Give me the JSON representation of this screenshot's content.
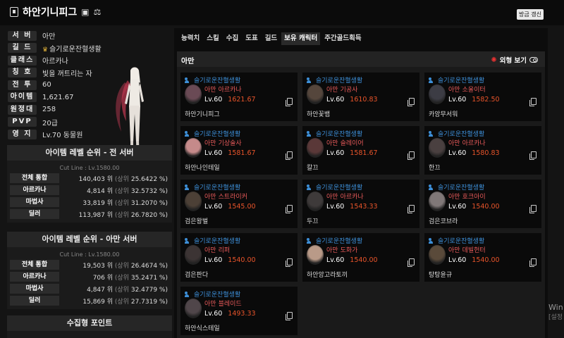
{
  "header": {
    "title": "하안기니피그",
    "refresh_label": "방금 갱신"
  },
  "profile": {
    "rows": [
      {
        "label": "서 버",
        "value": "아만",
        "crown": false
      },
      {
        "label": "길 드",
        "value": "슬기로운잔혈생활",
        "crown": true
      },
      {
        "label": "클래스",
        "value": "아르카나",
        "crown": false
      },
      {
        "label": "칭 호",
        "value": "빛을 꺼트리는 자",
        "crown": false
      },
      {
        "label": "전 투",
        "value": "60",
        "crown": false
      },
      {
        "label": "아이템",
        "value": "1,621.67",
        "crown": false
      },
      {
        "label": "원정대",
        "value": "258",
        "crown": false
      },
      {
        "label": "PVP",
        "value": "20급",
        "crown": false
      },
      {
        "label": "영 지",
        "value": "Lv.70 동물원",
        "crown": false
      }
    ]
  },
  "rank_all": {
    "title": "아이템 레벨 순위 - 전 서버",
    "cutline": "Cut Line : Lv.1580.00",
    "rows": [
      {
        "label": "전체 통합",
        "rank": "140,403 위",
        "pct_label": "(상위",
        "pct": "25.6422 %)"
      },
      {
        "label": "아르카나",
        "rank": "4,814 위",
        "pct_label": "(상위",
        "pct": "32.5732 %)"
      },
      {
        "label": "마법사",
        "rank": "33,819 위",
        "pct_label": "(상위",
        "pct": "31.2070 %)"
      },
      {
        "label": "딜러",
        "rank": "113,987 위",
        "pct_label": "(상위",
        "pct": "26.7820 %)"
      }
    ]
  },
  "rank_server": {
    "title": "아이템 레벨 순위 - 아만 서버",
    "cutline": "Cut Line : Lv.1580.00",
    "rows": [
      {
        "label": "전체 통합",
        "rank": "19,503 위",
        "pct_label": "(상위",
        "pct": "26.4674 %)"
      },
      {
        "label": "아르카나",
        "rank": "706 위",
        "pct_label": "(상위",
        "pct": "35.2471 %)"
      },
      {
        "label": "마법사",
        "rank": "4,847 위",
        "pct_label": "(상위",
        "pct": "32.4779 %)"
      },
      {
        "label": "딜러",
        "rank": "15,869 위",
        "pct_label": "(상위",
        "pct": "27.7319 %)"
      }
    ]
  },
  "collect": {
    "title": "수집형 포인트"
  },
  "tabs": [
    "능력치",
    "스킬",
    "수집",
    "도표",
    "길드",
    "보유 캐릭터",
    "주간골드획득"
  ],
  "active_tab": 5,
  "roster": {
    "server": "아만",
    "view_label": "외형 보기",
    "characters": [
      {
        "guild": "슬기로운잔혈생활",
        "server": "아만",
        "class": "아르카나",
        "level": "Lv.60",
        "ilvl": "1621.67",
        "name": "하안기니피그",
        "tone": "#6a4a55"
      },
      {
        "guild": "슬기로운잔혈생활",
        "server": "아만",
        "class": "기공사",
        "level": "Lv.60",
        "ilvl": "1610.83",
        "name": "하안꽃뱀",
        "tone": "#55463c"
      },
      {
        "guild": "슬기로운잔혈생활",
        "server": "아만",
        "class": "소울이터",
        "level": "Lv.60",
        "ilvl": "1582.50",
        "name": "카앙무서워",
        "tone": "#3c3c44"
      },
      {
        "guild": "슬기로운잔혈생활",
        "server": "아만",
        "class": "기상술사",
        "level": "Lv.60",
        "ilvl": "1581.67",
        "name": "하안나인테일",
        "tone": "#c58a8a"
      },
      {
        "guild": "슬기로운잔혈생활",
        "server": "아만",
        "class": "슬레이어",
        "level": "Lv.60",
        "ilvl": "1581.67",
        "name": "칼끄",
        "tone": "#5a3838"
      },
      {
        "guild": "슬기로운잔혈생활",
        "server": "아만",
        "class": "아르카나",
        "level": "Lv.60",
        "ilvl": "1580.83",
        "name": "한끄",
        "tone": "#4a4040"
      },
      {
        "guild": "슬기로운잔혈생활",
        "server": "아만",
        "class": "스트라이커",
        "level": "Lv.60",
        "ilvl": "1545.00",
        "name": "검은왕벌",
        "tone": "#4c4036"
      },
      {
        "guild": "슬기로운잔혈생활",
        "server": "아만",
        "class": "아르카나",
        "level": "Lv.60",
        "ilvl": "1543.33",
        "name": "두끄",
        "tone": "#3e3a3a"
      },
      {
        "guild": "슬기로운잔혈생활",
        "server": "아만",
        "class": "호크아이",
        "level": "Lv.60",
        "ilvl": "1540.00",
        "name": "검은코브라",
        "tone": "#807878"
      },
      {
        "guild": "슬기로운잔혈생활",
        "server": "아만",
        "class": "리퍼",
        "level": "Lv.60",
        "ilvl": "1540.00",
        "name": "검은판다",
        "tone": "#3c3434"
      },
      {
        "guild": "슬기로운잔혈생활",
        "server": "아만",
        "class": "도화가",
        "level": "Lv.60",
        "ilvl": "1540.00",
        "name": "하안앙고라토끼",
        "tone": "#b99a88"
      },
      {
        "guild": "슬기로운잔혈생활",
        "server": "아만",
        "class": "데빌헌터",
        "level": "Lv.60",
        "ilvl": "1540.00",
        "name": "탕탕윤규",
        "tone": "#5a4a3a"
      },
      {
        "guild": "슬기로운잔혈생활",
        "server": "아만",
        "class": "블레이드",
        "level": "Lv.60",
        "ilvl": "1493.33",
        "name": "하안식스테일",
        "tone": "#50464a"
      }
    ]
  },
  "watermark": {
    "line1": "Win",
    "line2": "[설정"
  }
}
